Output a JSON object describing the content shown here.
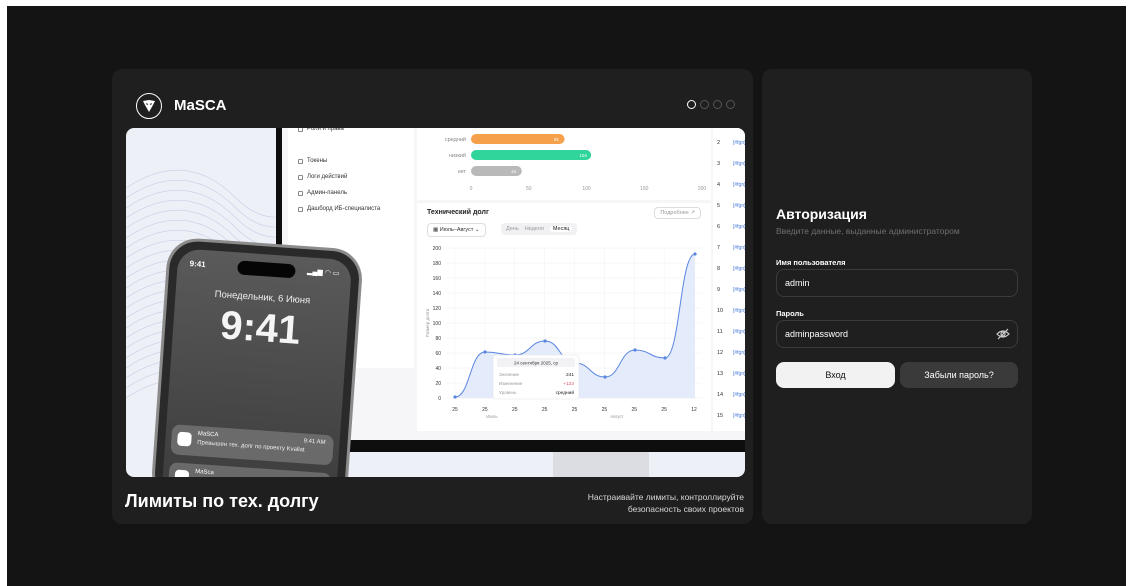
{
  "brand": {
    "name": "MaSCA",
    "logo_icon": "shield-mask-icon"
  },
  "carousel": {
    "total": 4,
    "active": 0
  },
  "slide": {
    "title": "Лимиты по тех. долгу",
    "description": "Настраивайте лимиты, контроллируйте безопасность своих проектов"
  },
  "dashboard": {
    "menu_items": [
      "Роли и права",
      "Токены",
      "Логи действий",
      "Админ-панель",
      "Дашборд ИБ-специалиста"
    ],
    "top_bars": {
      "categories": [
        "средний",
        "низкий",
        "нет"
      ],
      "values": [
        81,
        104,
        44
      ],
      "colors": [
        "#f5a04a",
        "#2fd59a",
        "#b9b9b9"
      ],
      "ticks": [
        "0",
        "50",
        "100",
        "150",
        "200"
      ]
    },
    "tech_debt": {
      "title": "Технический долг",
      "details_label": "Подробнее ↗",
      "range_label": "Июль–Август",
      "periods": [
        "День",
        "Неделя",
        "Месяц"
      ],
      "y_ticks": [
        "200",
        "180",
        "160",
        "140",
        "120",
        "100",
        "80",
        "60",
        "40",
        "20",
        "0"
      ],
      "y_label": "Размер долга",
      "x_ticks": [
        "25",
        "25",
        "25",
        "25",
        "25",
        "25",
        "25",
        "25",
        "12"
      ],
      "x_groups": [
        "Июль",
        "Август"
      ],
      "tooltip": {
        "date": "24 сентября 2025, ср",
        "rows": [
          {
            "label": "Значение",
            "value": "241"
          },
          {
            "label": "Изменение",
            "value": "+123"
          },
          {
            "label": "Уровень",
            "value": "средний"
          }
        ]
      }
    },
    "side_numbers": [
      "2",
      "3",
      "4",
      "5",
      "6",
      "7",
      "8",
      "9",
      "10",
      "11",
      "12",
      "13",
      "14",
      "15"
    ],
    "side_link": "[#fgn]"
  },
  "phone": {
    "status_time": "9:41",
    "date": "Понедельник, 6 Июня",
    "time": "9:41",
    "notification": {
      "app": "MaSCA",
      "time": "9:41 AM",
      "message": "Превышен тех. долг по проекту Kvallat"
    },
    "notification2_app": "MaSca"
  },
  "auth": {
    "title": "Авторизация",
    "subtitle": "Введите данные, выданные администратором",
    "username_label": "Имя пользователя",
    "username_value": "admin",
    "password_label": "Пароль",
    "password_value": "adminpassword",
    "login_button": "Вход",
    "forgot_button": "Забыли пароль?"
  }
}
